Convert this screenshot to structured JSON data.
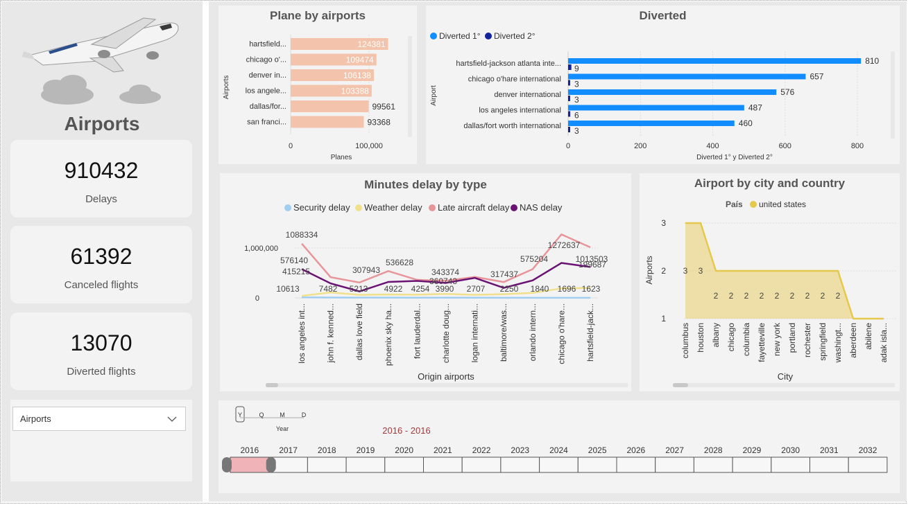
{
  "sidebar": {
    "title": "Airports",
    "kpis": [
      {
        "value": "910432",
        "label": "Delays"
      },
      {
        "value": "61392",
        "label": "Canceled flights"
      },
      {
        "value": "13070",
        "label": "Diverted flights"
      }
    ],
    "slicer": {
      "value": "Airports"
    }
  },
  "plane_by_airports": {
    "title": "Plane by airports",
    "ylabel": "Airports",
    "xlabel": "Planes",
    "xticks": [
      "0",
      "100,000"
    ],
    "categories": [
      "hartsfield...",
      "chicago o'...",
      "denver in...",
      "los angele...",
      "dallas/for...",
      "san franci..."
    ],
    "labels": [
      "124381",
      "109474",
      "106138",
      "103388",
      "99561",
      "93368"
    ]
  },
  "diverted": {
    "title": "Diverted",
    "legend": [
      "Diverted 1°",
      "Diverted 2°"
    ],
    "ylabel": "Airport",
    "xlabel": "Diverted 1° y Diverted 2°",
    "categories": [
      "hartsfield-jackson atlanta inte...",
      "chicago o'hare international",
      "denver international",
      "los angeles international",
      "dallas/fort worth international"
    ],
    "xticks": [
      "0",
      "200",
      "400",
      "600",
      "800"
    ],
    "labels1": [
      "810",
      "657",
      "576",
      "487",
      "460"
    ],
    "labels2": [
      "9",
      "3",
      "3",
      "6",
      "3"
    ]
  },
  "minutes_delay": {
    "title": "Minutes delay by type",
    "legend": [
      "Security delay",
      "Weather delay",
      "Late aircraft delay",
      "NAS delay"
    ],
    "xlabel": "Origin airports",
    "yticks": [
      "1,000,000",
      "0"
    ],
    "categories": [
      "los angeles int...",
      "john f. kenned...",
      "dallas love field",
      "phoenix sky ha...",
      "fort lauderdal...",
      "charlotte doug...",
      "logan internati...",
      "baltimore/was...",
      "orlando intern...",
      "chicago o'hare...",
      "hartsfield-jack..."
    ],
    "data_labels": [
      "1088334",
      "576140",
      "415215",
      "10613",
      "7482",
      "307943",
      "5213",
      "536628",
      "4922",
      "4254",
      "360743",
      "343374",
      "3990",
      "2707",
      "317437",
      "2250",
      "575204",
      "1840",
      "1272637",
      "1696",
      "1013503",
      "199687",
      "1623"
    ]
  },
  "airport_city": {
    "title": "Airport by city and country",
    "legend_title": "País",
    "legend_item": "united states",
    "ylabel": "Airports",
    "xlabel": "City",
    "yticks": [
      "3",
      "2",
      "1"
    ],
    "categories": [
      "columbus",
      "houston",
      "albany",
      "chicago",
      "columbia",
      "fayetteville",
      "new york",
      "portland",
      "rochester",
      "springfield",
      "washingt...",
      "aberdeen",
      "abilene",
      "adak isla..."
    ],
    "point_labels": [
      "3",
      "3",
      "2",
      "2",
      "2",
      "2",
      "2",
      "2",
      "2",
      "2",
      "2"
    ]
  },
  "timeline": {
    "granularity": [
      "Y",
      "Q",
      "M",
      "D"
    ],
    "granularity_label": "Year",
    "range_label": "2016 - 2016",
    "years": [
      "2016",
      "2017",
      "2018",
      "2019",
      "2020",
      "2021",
      "2022",
      "2023",
      "2024",
      "2025",
      "2026",
      "2027",
      "2028",
      "2029",
      "2030",
      "2031",
      "2032"
    ]
  },
  "chart_data": [
    {
      "type": "bar",
      "title": "Plane by airports",
      "xlabel": "Planes",
      "ylabel": "Airports",
      "categories": [
        "hartsfield...",
        "chicago o'...",
        "denver in...",
        "los angele...",
        "dallas/for...",
        "san franci..."
      ],
      "values": [
        124381,
        109474,
        106138,
        103388,
        99561,
        93368
      ],
      "color": "#f4c3ab"
    },
    {
      "type": "bar",
      "title": "Diverted",
      "xlabel": "Diverted 1° y Diverted 2°",
      "ylabel": "Airport",
      "xlim": [
        0,
        850
      ],
      "categories": [
        "hartsfield-jackson atlanta inte...",
        "chicago o'hare international",
        "denver international",
        "los angeles international",
        "dallas/fort worth international"
      ],
      "series": [
        {
          "name": "Diverted 1°",
          "values": [
            810,
            657,
            576,
            487,
            460
          ],
          "color": "#118dff"
        },
        {
          "name": "Diverted 2°",
          "values": [
            9,
            3,
            3,
            6,
            3
          ],
          "color": "#12239e"
        }
      ]
    },
    {
      "type": "line",
      "title": "Minutes delay by type",
      "xlabel": "Origin airports",
      "ylim": [
        0,
        1350000
      ],
      "categories": [
        "los angeles int...",
        "john f. kenned...",
        "dallas love field",
        "phoenix sky ha...",
        "fort lauderdal...",
        "charlotte doug...",
        "logan internati...",
        "baltimore/was...",
        "orlando intern...",
        "chicago o'hare...",
        "hartsfield-jack..."
      ],
      "series": [
        {
          "name": "Security delay",
          "color": "#a0cdf0",
          "values": [
            10613,
            7482,
            5213,
            4922,
            4254,
            3990,
            2707,
            2250,
            1840,
            1696,
            1623
          ]
        },
        {
          "name": "Weather delay",
          "color": "#f0e08c",
          "values": [
            40000,
            110000,
            60000,
            70000,
            65000,
            80000,
            60000,
            75000,
            100000,
            190000,
            199687
          ]
        },
        {
          "name": "Late aircraft delay",
          "color": "#e8959a",
          "values": [
            1088334,
            415215,
            307943,
            536628,
            360743,
            343374,
            420000,
            317437,
            575204,
            1272637,
            1013503
          ]
        },
        {
          "name": "NAS delay",
          "color": "#6a1374",
          "values": [
            576140,
            290000,
            130000,
            320000,
            340000,
            300000,
            400000,
            200000,
            350000,
            700000,
            620000
          ]
        }
      ]
    },
    {
      "type": "area",
      "title": "Airport by city and country",
      "xlabel": "City",
      "ylabel": "Airports",
      "ylim": [
        1,
        3
      ],
      "categories": [
        "columbus",
        "houston",
        "albany",
        "chicago",
        "columbia",
        "fayetteville",
        "new york",
        "portland",
        "rochester",
        "springfield",
        "washingt...",
        "aberdeen",
        "abilene",
        "adak isla..."
      ],
      "series": [
        {
          "name": "united states",
          "color": "#e6c84c",
          "values": [
            3,
            3,
            2,
            2,
            2,
            2,
            2,
            2,
            2,
            2,
            2,
            1,
            1,
            1
          ]
        }
      ]
    }
  ]
}
